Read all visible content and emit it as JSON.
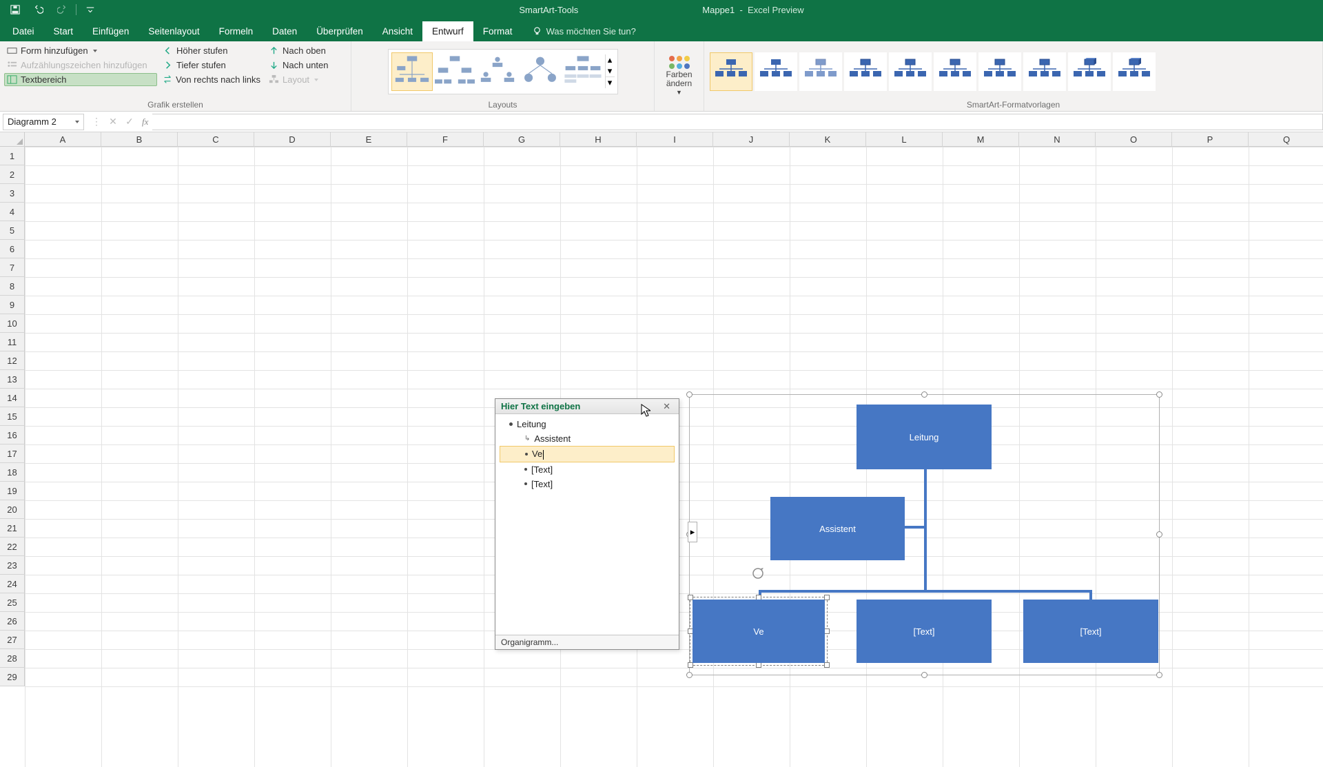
{
  "titlebar": {
    "smartart_tools": "SmartArt-Tools",
    "doc": "Mappe1",
    "product": "Excel Preview"
  },
  "tabs": {
    "datei": "Datei",
    "start": "Start",
    "einfuegen": "Einfügen",
    "seitenlayout": "Seitenlayout",
    "formeln": "Formeln",
    "daten": "Daten",
    "ueberpruefen": "Überprüfen",
    "ansicht": "Ansicht",
    "entwurf": "Entwurf",
    "format": "Format",
    "tell_me": "Was möchten Sie tun?"
  },
  "ribbon": {
    "create": {
      "add_shape": "Form hinzufügen",
      "bullet": "Aufzählungszeichen hinzufügen",
      "textpane": "Textbereich",
      "promote": "Höher stufen",
      "demote": "Tiefer stufen",
      "rtl": "Von rechts nach links",
      "up": "Nach oben",
      "down": "Nach unten",
      "layoutbtn": "Layout",
      "group": "Grafik erstellen"
    },
    "layouts": {
      "group": "Layouts"
    },
    "colors": {
      "btn": "Farben\nändern"
    },
    "styles": {
      "group": "SmartArt-Formatvorlagen"
    }
  },
  "colors_palette": [
    "#e46c4b",
    "#f2a447",
    "#f1cc47",
    "#78b766",
    "#54aee0",
    "#5076c0"
  ],
  "fxbar": {
    "name": "Diagramm 2"
  },
  "columns": [
    "A",
    "B",
    "C",
    "D",
    "E",
    "F",
    "G",
    "H",
    "I",
    "J",
    "K",
    "L",
    "M",
    "N",
    "O",
    "P",
    "Q"
  ],
  "rows": [
    "1",
    "2",
    "3",
    "4",
    "5",
    "6",
    "7",
    "8",
    "9",
    "10",
    "11",
    "12",
    "13",
    "14",
    "15",
    "16",
    "17",
    "18",
    "19",
    "20",
    "21",
    "22",
    "23",
    "24",
    "25",
    "26",
    "27",
    "28",
    "29"
  ],
  "textpane": {
    "title": "Hier Text eingeben",
    "items": {
      "leitung": "Leitung",
      "assistent": "Assistent",
      "ve": "Ve",
      "t1": "[Text]",
      "t2": "[Text]"
    },
    "footer": "Organigramm..."
  },
  "smartart": {
    "leitung": "Leitung",
    "assistent": "Assistent",
    "ve": "Ve",
    "t1": "[Text]",
    "t2": "[Text]"
  }
}
